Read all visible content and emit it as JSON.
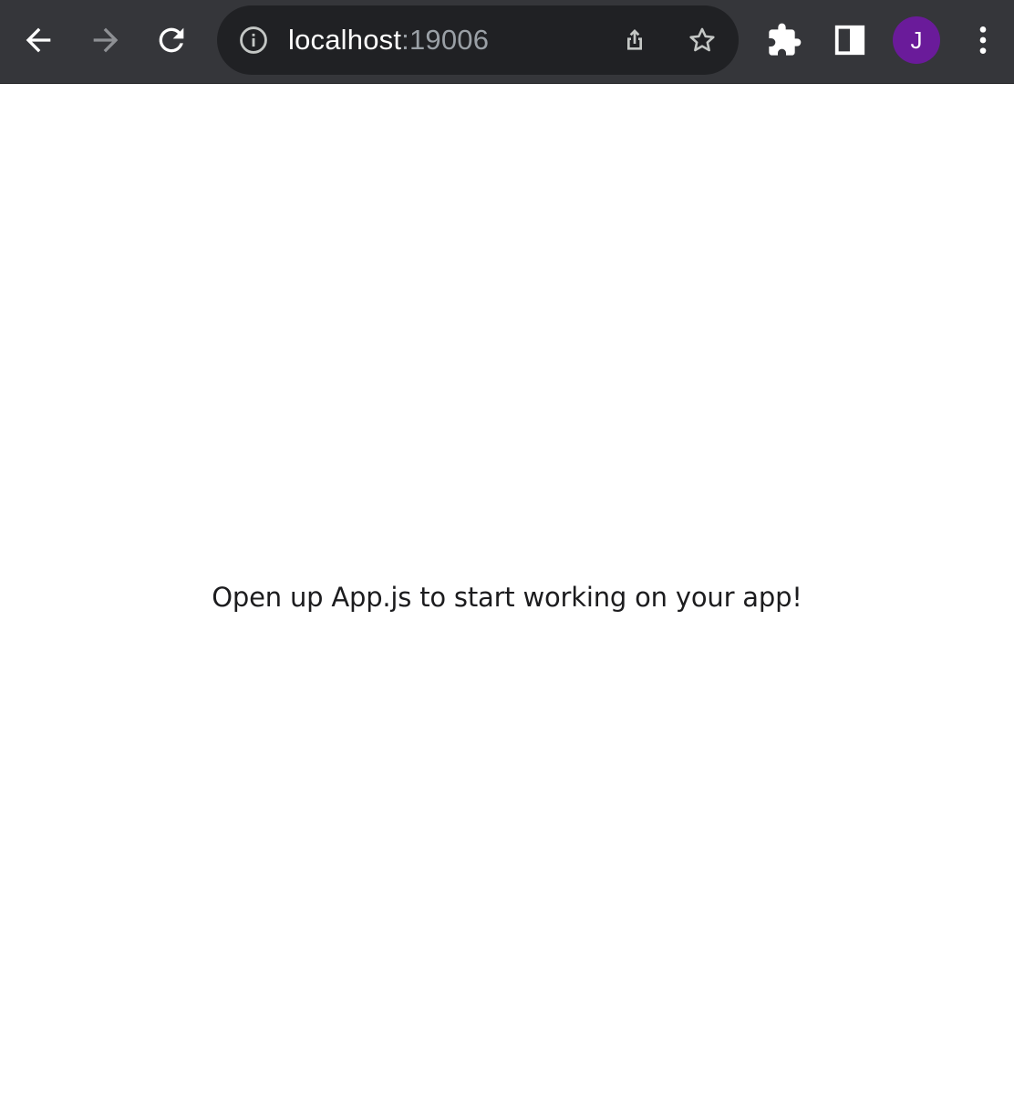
{
  "browser": {
    "url_host": "localhost",
    "url_port": ":19006",
    "profile_initial": "J",
    "profile_color": "#6a1b9a",
    "toolbar_color": "#35363a",
    "icons": {
      "back": "arrow-left-icon",
      "forward": "arrow-right-icon",
      "reload": "reload-icon",
      "site_info": "info-circle-icon",
      "share": "share-icon",
      "bookmark": "star-icon",
      "extensions": "puzzle-icon",
      "side_panel": "side-panel-icon",
      "menu": "kebab-menu-icon"
    }
  },
  "page": {
    "message": "Open up App.js to start working on your app!"
  }
}
